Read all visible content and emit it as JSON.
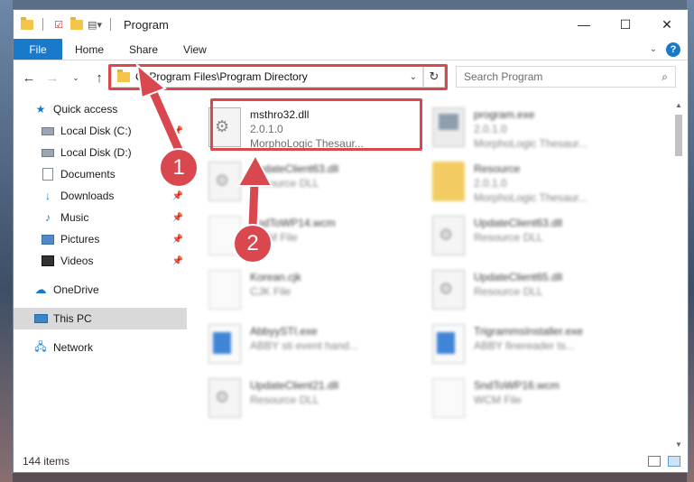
{
  "window": {
    "title": "Program",
    "qat_icons": [
      "folder-icon",
      "properties-icon",
      "new-folder-icon",
      "customize-icon"
    ],
    "controls": [
      "minimize-icon",
      "maximize-icon",
      "close-icon"
    ]
  },
  "ribbon": {
    "file_label": "File",
    "tabs": [
      "Home",
      "Share",
      "View"
    ],
    "help": "?"
  },
  "address": {
    "path": "C:\\Program Files\\Program Directory",
    "search_placeholder": "Search Program"
  },
  "nav": {
    "items": [
      {
        "label": "Quick access",
        "icon": "star-icon"
      },
      {
        "label": "Local Disk (C:)",
        "icon": "disk-icon",
        "pinned": true
      },
      {
        "label": "Local Disk (D:)",
        "icon": "disk-icon"
      },
      {
        "label": "Documents",
        "icon": "documents-icon"
      },
      {
        "label": "Downloads",
        "icon": "downloads-icon",
        "pinned": true
      },
      {
        "label": "Music",
        "icon": "music-icon",
        "pinned": true
      },
      {
        "label": "Pictures",
        "icon": "pictures-icon",
        "pinned": true
      },
      {
        "label": "Videos",
        "icon": "videos-icon",
        "pinned": true
      },
      {
        "label": "OneDrive",
        "icon": "onedrive-icon"
      },
      {
        "label": "This PC",
        "icon": "pc-icon",
        "selected": true
      },
      {
        "label": "Network",
        "icon": "network-icon"
      }
    ]
  },
  "files": [
    {
      "name": "msthro32.dll",
      "line2": "2.0.1.0",
      "line3": "MorphoLogic Thesaur...",
      "icon": "dll-icon",
      "highlighted": true
    },
    {
      "name": "program.exe",
      "line2": "2.0.1.0",
      "line3": "MorphoLogic Thesaur...",
      "icon": "exe-icon"
    },
    {
      "name": "UpdateClient63.dll",
      "line2": "Resource DLL",
      "icon": "dll-icon"
    },
    {
      "name": "Resource",
      "line2": "2.0.1.0",
      "line3": "MorphoLogic Thesaur...",
      "icon": "folder-icon"
    },
    {
      "name": "SndToWP14.wcm",
      "line2": "WCM File",
      "icon": "file-icon"
    },
    {
      "name": "UpdateClient63.dll",
      "line2": "Resource DLL",
      "icon": "dll-icon"
    },
    {
      "name": "Korean.cjk",
      "line2": "CJK File",
      "icon": "file-icon"
    },
    {
      "name": "UpdateClient65.dll",
      "line2": "Resource DLL",
      "icon": "dll-icon"
    },
    {
      "name": "AbbyySTI.exe",
      "line2": "ABBY sti event hand...",
      "icon": "exe-icon"
    },
    {
      "name": "TrigrammsInstaller.exe",
      "line2": "ABBY finereader ts...",
      "icon": "exe-icon"
    },
    {
      "name": "UpdateClient21.dll",
      "line2": "Resource DLL",
      "icon": "dll-icon"
    },
    {
      "name": "SndToWP16.wcm",
      "line2": "WCM File",
      "icon": "file-icon"
    }
  ],
  "status": {
    "count": "144 items"
  },
  "annotations": {
    "step1": "1",
    "step2": "2",
    "color": "#d9474f"
  }
}
